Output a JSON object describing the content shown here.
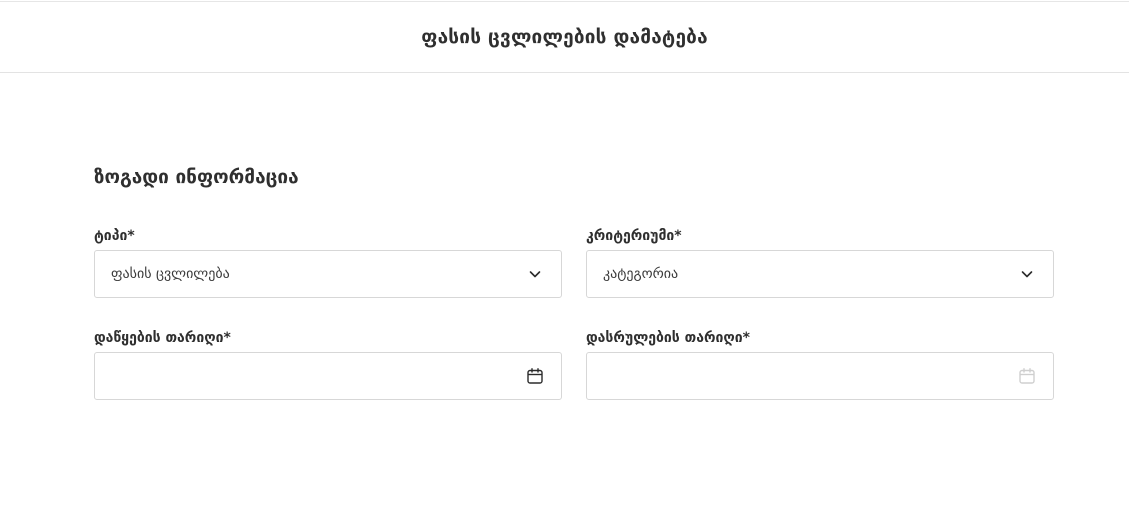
{
  "header": {
    "title": "ფასის ცვლილების დამატება"
  },
  "section": {
    "title": "ზოგადი ინფორმაცია"
  },
  "form": {
    "type": {
      "label": "ტიპი*",
      "value": "ფასის ცვლილება"
    },
    "criteria": {
      "label": "კრიტერიუმი*",
      "value": "კატეგორია"
    },
    "start_date": {
      "label": "დაწყების თარიღი*",
      "value": "",
      "icon": "calendar-icon"
    },
    "end_date": {
      "label": "დასრულების თარიღი*",
      "value": "",
      "icon": "calendar-icon",
      "disabled": true
    }
  },
  "colors": {
    "border": "#d7d7d7",
    "text": "#2f2f2f",
    "disabled_icon": "#c8c8c8"
  }
}
